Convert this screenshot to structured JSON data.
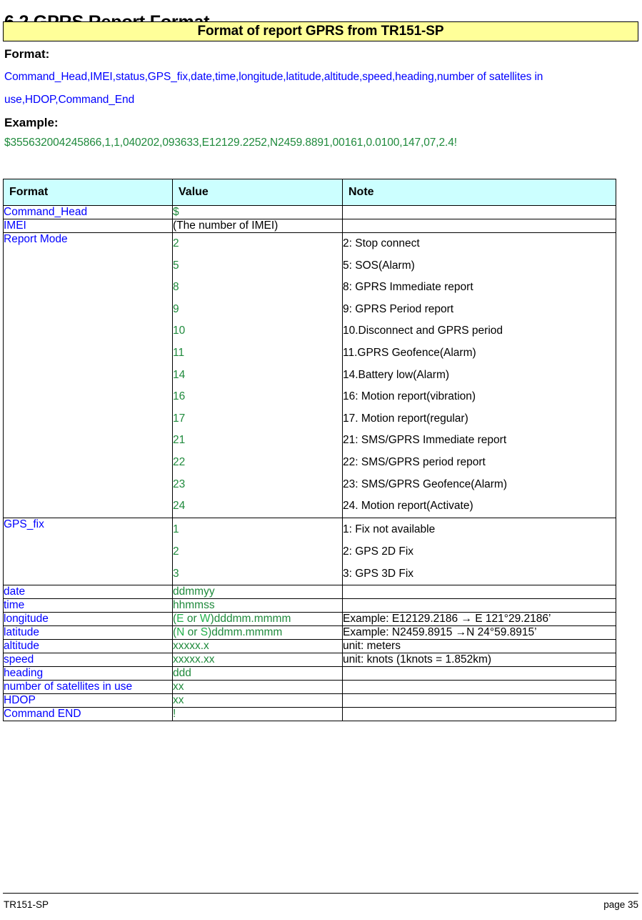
{
  "section": {
    "number_title": "6.2 GPRS Report Format"
  },
  "banner": {
    "title": "Format of report GPRS from TR151-SP",
    "background_color": "#FFFF99"
  },
  "format_block": {
    "label": "Format:",
    "line1": "Command_Head,IMEI,status,GPS_fix,date,time,longitude,latitude,altitude,speed,heading,number of satellites in",
    "line2": "use,HDOP,Command_End",
    "text_color": "#0000FF"
  },
  "example_block": {
    "label": "Example:",
    "line": "$355632004245866,1,1,040202,093633,E12129.2252,N2459.8891,00161,0.0100,147,07,2.4!",
    "text_color": "#1F8A3C"
  },
  "table": {
    "header_background": "#CCFFFF",
    "columns": [
      "Format",
      "Value",
      "Note"
    ],
    "rows": [
      {
        "format": "Command_Head",
        "values": [
          "$"
        ],
        "notes": [
          ""
        ]
      },
      {
        "format": "IMEI",
        "values": [
          "(The number of IMEI)"
        ],
        "value_plain": true,
        "notes": [
          ""
        ]
      },
      {
        "format": "Report Mode",
        "values": [
          "2",
          "5",
          "8",
          "9",
          "10",
          "11",
          "14",
          "16",
          "17",
          "21",
          "22",
          "23",
          "24"
        ],
        "notes": [
          "2: Stop connect",
          "5: SOS(Alarm)",
          "8: GPRS Immediate report",
          "9: GPRS Period report",
          "10.Disconnect and GPRS period",
          "11.GPRS Geofence(Alarm)",
          "14.Battery low(Alarm)",
          "16: Motion report(vibration)",
          "17. Motion report(regular)",
          "21: SMS/GPRS Immediate report",
          "22: SMS/GPRS period report",
          "23: SMS/GPRS Geofence(Alarm)",
          "24. Motion report(Activate)"
        ]
      },
      {
        "format": "GPS_fix",
        "values": [
          "1",
          "2",
          "3"
        ],
        "notes": [
          "1: Fix not available",
          "2: GPS 2D Fix",
          "3: GPS 3D Fix"
        ]
      },
      {
        "format": "date",
        "values": [
          "ddmmyy"
        ],
        "notes": [
          ""
        ]
      },
      {
        "format": "time",
        "values": [
          "hhmmss"
        ],
        "notes": [
          ""
        ]
      },
      {
        "format": "longitude",
        "value_rich": {
          "prefix": "(",
          "hl1": "E",
          "mid": " or ",
          "hl2": "W",
          "suffix": ")dddmm.mmmm"
        },
        "notes": [
          "Example:   E12129.2186  →  E 121°29.2186’"
        ]
      },
      {
        "format": "latitude",
        "value_rich": {
          "prefix": "(",
          "hl1": "N",
          "mid": " or ",
          "hl2": "S",
          "suffix": ")ddmm.mmmm"
        },
        "notes": [
          "Example:   N2459.8915  →N 24°59.8915’"
        ]
      },
      {
        "format": "altitude",
        "values": [
          "xxxxx.x"
        ],
        "notes": [
          "unit: meters"
        ]
      },
      {
        "format": "speed",
        "values": [
          "xxxxx.xx"
        ],
        "notes": [
          "unit: knots (1knots = 1.852km)"
        ]
      },
      {
        "format": "heading",
        "values": [
          "ddd"
        ],
        "notes": [
          ""
        ]
      },
      {
        "format": "number of satellites in use",
        "values": [
          "xx"
        ],
        "notes": [
          ""
        ]
      },
      {
        "format": "HDOP",
        "values": [
          "xx"
        ],
        "notes": [
          ""
        ]
      },
      {
        "format": "Command END",
        "values": [
          "!"
        ],
        "notes": [
          ""
        ]
      }
    ]
  },
  "footer": {
    "left": "TR151-SP",
    "right": "page 35"
  }
}
